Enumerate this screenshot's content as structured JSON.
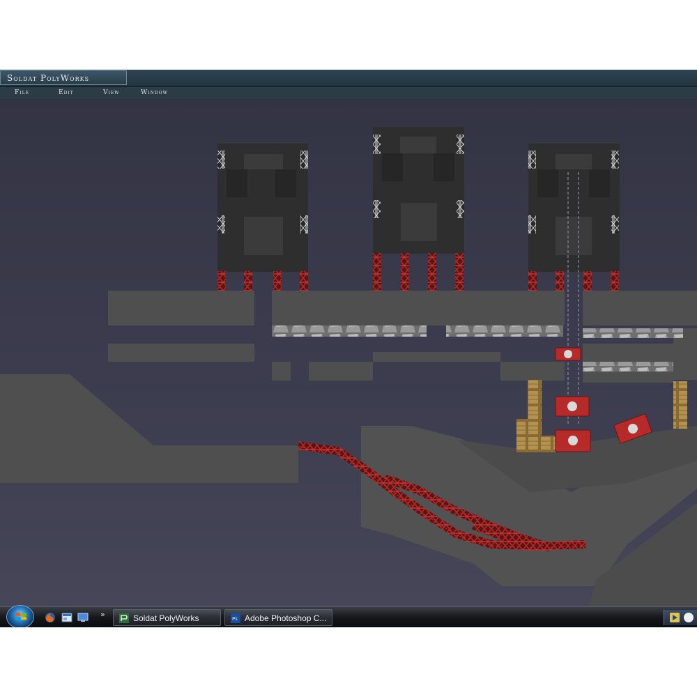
{
  "window": {
    "title": "Soldat PolyWorks",
    "menu": [
      "File",
      "Edit",
      "View",
      "Window"
    ]
  },
  "taskbar": {
    "quick_launch": [
      "firefox-icon",
      "show-desktop-icon",
      "switch-windows-icon"
    ],
    "more": "»",
    "tasks": [
      {
        "label": "Soldat PolyWorks",
        "icon": "polyworks-icon"
      },
      {
        "label": "Adobe Photoshop C...",
        "icon": "photoshop-icon"
      }
    ]
  },
  "colors": {
    "ground": "#4f4f4f",
    "tower": "#2e2e2e",
    "girder": "#8f2121",
    "crate": "#b3924f",
    "barrel": "#b62a2a",
    "background": "#3a3a4c",
    "title_bar": "#2f4452"
  }
}
